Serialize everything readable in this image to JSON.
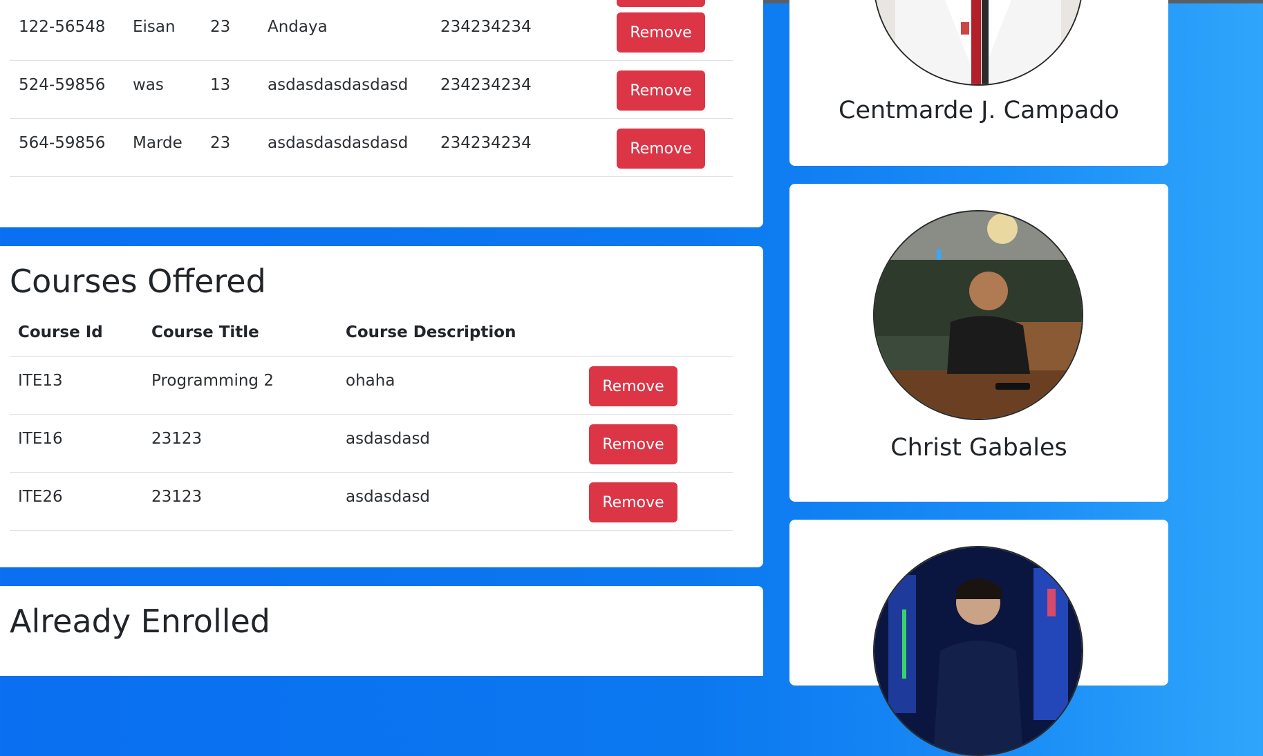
{
  "students": {
    "rows": [
      {
        "id": "122-56548",
        "name": "Eisan",
        "age": "23",
        "address": "Andaya",
        "contact": "234234234",
        "action": "Remove"
      },
      {
        "id": "524-59856",
        "name": "was",
        "age": "13",
        "address": "asdasdasdasdasd",
        "contact": "234234234",
        "action": "Remove"
      },
      {
        "id": "564-59856",
        "name": "Marde",
        "age": "23",
        "address": "asdasdasdasdasd",
        "contact": "234234234",
        "action": "Remove"
      }
    ]
  },
  "courses": {
    "title": "Courses Offered",
    "headers": {
      "id": "Course Id",
      "title": "Course Title",
      "description": "Course Description"
    },
    "rows": [
      {
        "id": "ITE13",
        "title": "Programming 2",
        "description": "ohaha",
        "action": "Remove"
      },
      {
        "id": "ITE16",
        "title": "23123",
        "description": "asdasdasd",
        "action": "Remove"
      },
      {
        "id": "ITE26",
        "title": "23123",
        "description": "asdasdasd",
        "action": "Remove"
      }
    ]
  },
  "enrolled": {
    "title": "Already Enrolled"
  },
  "team": [
    {
      "name": "Centmarde J. Campado"
    },
    {
      "name": "Christ Gabales"
    },
    {
      "name": ""
    }
  ],
  "colors": {
    "danger": "#dc3545",
    "background_blue": "#0b78f0",
    "card": "#ffffff"
  }
}
